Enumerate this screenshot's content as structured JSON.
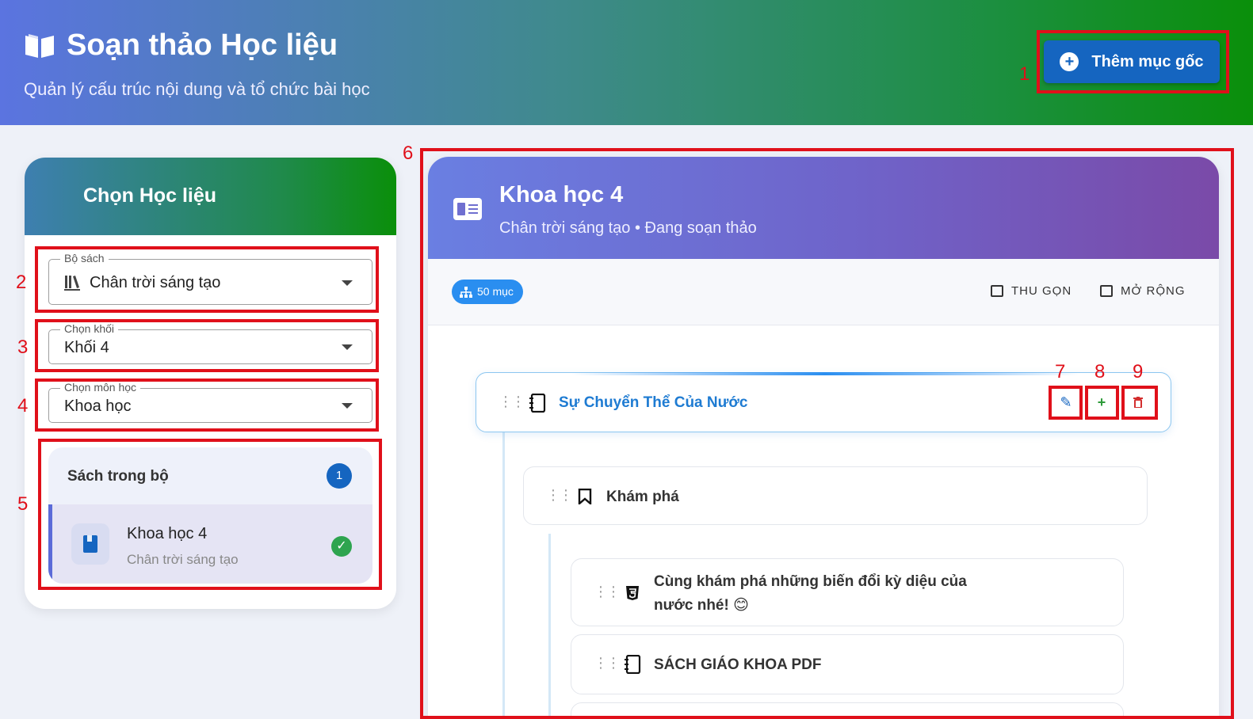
{
  "header": {
    "title": "Soạn thảo Học liệu",
    "subtitle": "Quản lý cấu trúc nội dung và tổ chức bài học",
    "add_root_label": "Thêm mục gốc"
  },
  "left_panel": {
    "title": "Chọn Học liệu",
    "book_set": {
      "label": "Bộ sách",
      "value": "Chân trời sáng tạo"
    },
    "grade": {
      "label": "Chọn khối",
      "value": "Khối 4"
    },
    "subject": {
      "label": "Chọn môn học",
      "value": "Khoa học"
    },
    "books_section": {
      "title": "Sách trong bộ",
      "count": "1",
      "items": [
        {
          "name": "Khoa học 4",
          "publisher": "Chân trời sáng tạo"
        }
      ]
    }
  },
  "editor": {
    "title": "Khoa học 4",
    "subtitle": "Chân trời sáng tạo • Đang soạn thảo",
    "item_count": "50 mục",
    "collapse_label": "THU GỌN",
    "expand_label": "MỞ RỘNG",
    "nodes": [
      {
        "label": "Sự Chuyển Thể Của Nước",
        "icon": "notebook-icon"
      },
      {
        "label": "Khám phá",
        "icon": "bookmark-icon"
      },
      {
        "label_line1": "Cùng khám phá những biến đổi kỳ diệu của",
        "label_line2": "nước nhé! 😊",
        "icon": "html5-icon"
      },
      {
        "label": "SÁCH GIÁO KHOA PDF",
        "icon": "notebook-icon"
      }
    ]
  },
  "annotations": [
    "1",
    "2",
    "3",
    "4",
    "5",
    "6",
    "7",
    "8",
    "9"
  ],
  "colors": {
    "primary": "#1565c0",
    "annotation": "#e0101a",
    "success": "#2ea44f"
  }
}
